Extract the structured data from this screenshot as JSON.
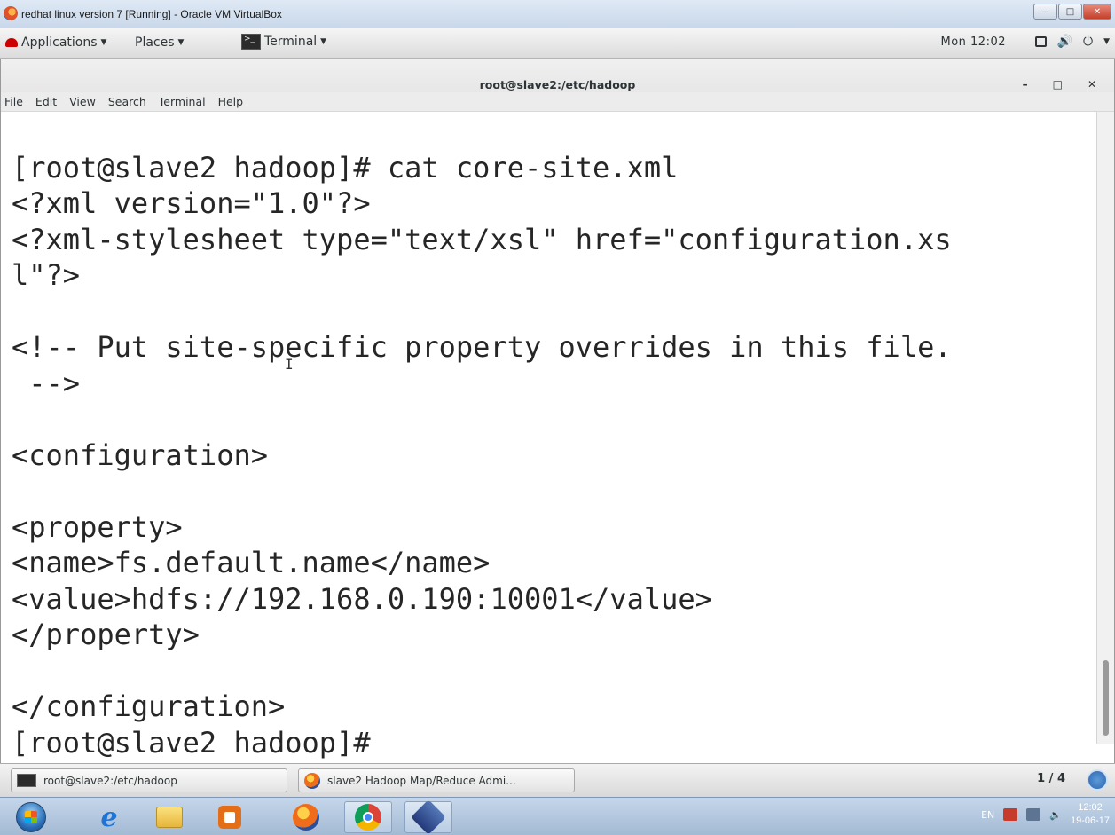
{
  "vbox": {
    "title": "redhat linux version 7 [Running] - Oracle VM VirtualBox"
  },
  "gnome_bar": {
    "applications": "Applications",
    "places": "Places",
    "terminal": "Terminal",
    "clock": "Mon 12:02"
  },
  "terminal": {
    "title": "root@slave2:/etc/hadoop",
    "menu": [
      "File",
      "Edit",
      "View",
      "Search",
      "Terminal",
      "Help"
    ],
    "lines": [
      "[root@slave2 hadoop]# cat core-site.xml",
      "<?xml version=\"1.0\"?>",
      "<?xml-stylesheet type=\"text/xsl\" href=\"configuration.xs",
      "l\"?>",
      "",
      "<!-- Put site-specific property overrides in this file.",
      " -->",
      "",
      "<configuration>",
      "",
      "<property>",
      "<name>fs.default.name</name>",
      "<value>hdfs://192.168.0.190:10001</value>",
      "</property>",
      "",
      "</configuration>",
      "[root@slave2 hadoop]#"
    ]
  },
  "window_list": {
    "items": [
      "root@slave2:/etc/hadoop",
      "slave2 Hadoop Map/Reduce Admi..."
    ],
    "workspace": "1 / 4"
  },
  "taskbar": {
    "lang": "EN",
    "time": "12:02",
    "date": "19-06-17"
  },
  "icons": {
    "vbox_app": "virtualbox-icon",
    "redhat": "redhat-icon",
    "firefox": "firefox-icon",
    "chrome": "chrome-icon",
    "ie": "internet-explorer-icon"
  }
}
